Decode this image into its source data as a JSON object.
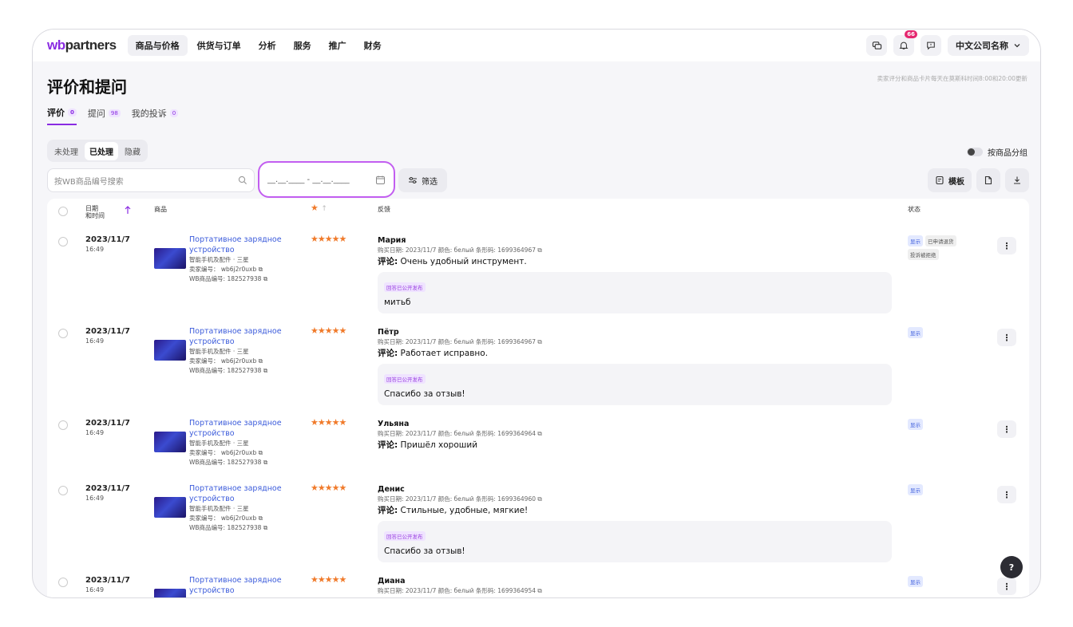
{
  "brand": {
    "prefix": "wb",
    "rest": "partners"
  },
  "nav": [
    "商品与价格",
    "供货与订单",
    "分析",
    "服务",
    "推广",
    "财务"
  ],
  "notification_count": "66",
  "company_name": "中文公司名称",
  "page_title": "评价和提问",
  "update_note": "卖家评分和商品卡片每天在莫斯科时间8:00和20:00更新",
  "tabs": [
    {
      "label": "评价",
      "count": "0"
    },
    {
      "label": "提问",
      "count": "98"
    },
    {
      "label": "我的投诉",
      "count": "0"
    }
  ],
  "segments": [
    "未处理",
    "已处理",
    "隐藏"
  ],
  "group_toggle_label": "按商品分组",
  "search_placeholder": "按WB商品编号搜索",
  "date_range_placeholder": "__.__.____ - __.__.____",
  "filter_label": "筛选",
  "template_label": "模板",
  "columns": {
    "date": "日期",
    "datetime": "和时间",
    "product": "商品",
    "feedback": "反馈",
    "status": "状态"
  },
  "rows": [
    {
      "date": "2023/11/7",
      "time": "16:49",
      "product_name": "Портативное зарядное устройство",
      "category": "智能手机及配件 · 三星",
      "seller_code": "卖家编号： wb6j2r0uxb",
      "wb_code": "WB商品编号: 182527938",
      "stars": "★★★★★",
      "name": "Мария",
      "meta": "购买日期: 2023/11/7   颜色: белый   条形码: 1699364967",
      "comment_label": "评论:",
      "comment": "Очень удобный инструмент.",
      "reply_tag": "回答已公开发布",
      "reply": "митьб",
      "status": [
        "显示",
        "已申请退货",
        "投诉被拒绝"
      ]
    },
    {
      "date": "2023/11/7",
      "time": "16:49",
      "product_name": "Портативное зарядное устройство",
      "category": "智能手机及配件 · 三星",
      "seller_code": "卖家编号： wb6j2r0uxb",
      "wb_code": "WB商品编号: 182527938",
      "stars": "★★★★★",
      "name": "Пётр",
      "meta": "购买日期: 2023/11/7   颜色: белый   条形码: 1699364967",
      "comment_label": "评论:",
      "comment": "Работает исправно.",
      "reply_tag": "回答已公开发布",
      "reply": "Спасибо за отзыв!",
      "status": [
        "显示"
      ]
    },
    {
      "date": "2023/11/7",
      "time": "16:49",
      "product_name": "Портативное зарядное устройство",
      "category": "智能手机及配件 · 三星",
      "seller_code": "卖家编号： wb6j2r0uxb",
      "wb_code": "WB商品编号: 182527938",
      "stars": "★★★★★",
      "name": "Ульяна",
      "meta": "购买日期: 2023/11/7   颜色: белый   条形码: 1699364964",
      "comment_label": "评论:",
      "comment": "Пришёл хороший",
      "status": [
        "显示"
      ]
    },
    {
      "date": "2023/11/7",
      "time": "16:49",
      "product_name": "Портативное зарядное устройство",
      "category": "智能手机及配件 · 三星",
      "seller_code": "卖家编号： wb6j2r0uxb",
      "wb_code": "WB商品编号: 182527938",
      "stars": "★★★★★",
      "name": "Денис",
      "meta": "购买日期: 2023/11/7   颜色: белый   条形码: 1699364960",
      "comment_label": "评论:",
      "comment": "Стильные, удобные, мягкие!",
      "reply_tag": "回答已公开发布",
      "reply": "Спасибо за отзыв!",
      "status": [
        "显示"
      ]
    },
    {
      "date": "2023/11/7",
      "time": "16:49",
      "product_name": "Портативное зарядное устройство",
      "stars": "★★★★★",
      "name": "Диана",
      "meta": "购买日期: 2023/11/7   颜色: белый   条形码: 1699364954",
      "status": [
        "显示"
      ]
    }
  ],
  "help_label": "?"
}
